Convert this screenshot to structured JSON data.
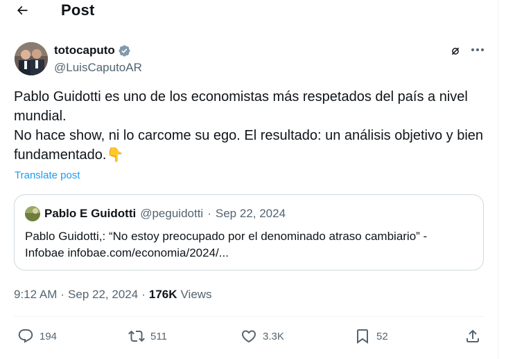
{
  "header": {
    "title": "Post"
  },
  "author": {
    "name": "totocaputo",
    "handle": "@LuisCaputoAR"
  },
  "tweet": {
    "lines": [
      "Pablo Guidotti es uno de los economistas más respetados del país a nivel mundial.",
      "No hace show, ni lo carcome su ego. El resultado: un análisis objetivo y bien fundamentado.👇"
    ],
    "translate_label": "Translate post"
  },
  "quote": {
    "name": "Pablo E Guidotti",
    "handle": "@peguidotti",
    "separator": "·",
    "date": "Sep 22, 2024",
    "line1": "Pablo Guidotti,: “No estoy preocupado por el denominado atraso cambiario” -",
    "line2": "Infobae infobae.com/economia/2024/..."
  },
  "meta": {
    "time": "9:12 AM",
    "separator": "·",
    "date": "Sep 22, 2024",
    "separator2": "·",
    "views_count": "176K",
    "views_label": "Views"
  },
  "actions": {
    "replies": "194",
    "reposts": "511",
    "likes": "3.3K",
    "bookmarks": "52"
  },
  "icons": {
    "back": "arrow-left-icon",
    "verified": "verified-badge-icon",
    "grok": "grok-icon",
    "more": "more-icon",
    "reply": "reply-icon",
    "repost": "repost-icon",
    "like": "heart-icon",
    "bookmark": "bookmark-icon",
    "share": "share-icon"
  },
  "colors": {
    "link": "#1d9bf0",
    "muted": "#536471",
    "text": "#0f1419",
    "border": "#cfd9de"
  }
}
